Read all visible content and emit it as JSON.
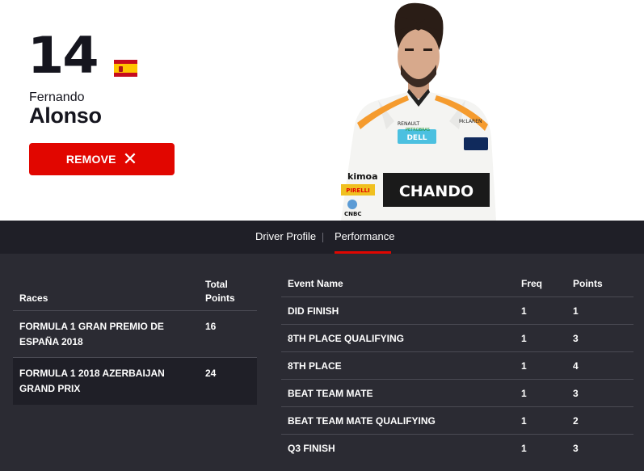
{
  "driver": {
    "number": "14",
    "first_name": "Fernando",
    "last_name": "Alonso",
    "flag_icon": "spain-flag-icon",
    "remove_label": "REMOVE",
    "remove_icon": "✕"
  },
  "portrait": {
    "sponsor_chest": "CHANDO",
    "sponsor_left": "kimoa",
    "sponsor_pirelli": "PIRELLI",
    "sponsor_cnbc": "CNBC",
    "sponsor_dell": "DELL",
    "sponsor_renault": "RENAULT",
    "sponsor_petrobras": "PETROBRAS",
    "sponsor_mclaren": "McLAREN"
  },
  "tabs": [
    {
      "label": "Driver Profile",
      "active": false
    },
    {
      "label": "Performance",
      "active": true
    }
  ],
  "races_table": {
    "headers": {
      "race": "Races",
      "points": "Total Points"
    },
    "rows": [
      {
        "race": "FORMULA 1 GRAN PREMIO DE ESPAÑA 2018",
        "points": "16"
      },
      {
        "race": "FORMULA 1 2018 AZERBAIJAN GRAND PRIX",
        "points": "24"
      }
    ]
  },
  "events_table": {
    "headers": {
      "event": "Event Name",
      "freq": "Freq",
      "points": "Points"
    },
    "rows": [
      {
        "event": "DID FINISH",
        "freq": "1",
        "points": "1"
      },
      {
        "event": "8TH PLACE QUALIFYING",
        "freq": "1",
        "points": "3"
      },
      {
        "event": "8TH PLACE",
        "freq": "1",
        "points": "4"
      },
      {
        "event": "BEAT TEAM MATE",
        "freq": "1",
        "points": "3"
      },
      {
        "event": "BEAT TEAM MATE QUALIFYING",
        "freq": "1",
        "points": "2"
      },
      {
        "event": "Q3 FINISH",
        "freq": "1",
        "points": "3"
      }
    ]
  },
  "colors": {
    "accent": "#e10600",
    "dark_bg": "#2b2b33",
    "tab_bg": "#1f1f27"
  }
}
